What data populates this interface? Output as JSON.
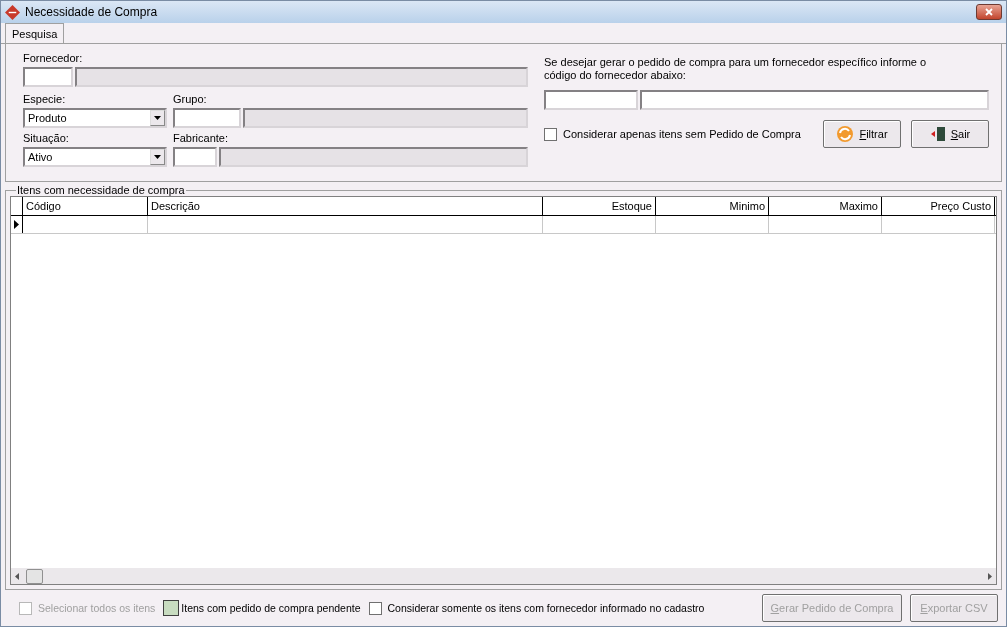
{
  "window": {
    "title": "Necessidade de Compra"
  },
  "tabs": [
    {
      "label": "Pesquisa",
      "selected": true
    }
  ],
  "filters": {
    "fornecedor": {
      "label": "Fornecedor:"
    },
    "especie": {
      "label": "Especie:",
      "value": "Produto"
    },
    "grupo": {
      "label": "Grupo:"
    },
    "situacao": {
      "label": "Situação:",
      "value": "Ativo"
    },
    "fabricante": {
      "label": "Fabricante:"
    }
  },
  "supplier_hint": "Se desejar gerar o pedido de compra para um fornecedor específico informe o código do fornecedor abaixo:",
  "only_without_order": {
    "label": "Considerar apenas itens sem Pedido de Compra",
    "checked": false
  },
  "actions": [
    {
      "label": "Filtrar",
      "kind": "refresh"
    },
    {
      "label": "Sair",
      "kind": "exit"
    }
  ],
  "grid": {
    "title": "Itens com necessidade de compra",
    "columns": [
      {
        "label": "Código"
      },
      {
        "label": "Descrição"
      },
      {
        "label": "Estoque"
      },
      {
        "label": "Minimo"
      },
      {
        "label": "Maximo"
      },
      {
        "label": "Preço Custo"
      }
    ],
    "rows": [
      {
        "current": true
      }
    ]
  },
  "footer": {
    "select_all": {
      "label": "Selecionar todos os itens",
      "checked": false,
      "disabled": true
    },
    "legend": {
      "label": "Itens com pedido de compra pendente",
      "color": "#c8dcc0"
    },
    "only_with_supplier": {
      "label": "Considerar somente os itens com fornecedor informado no cadastro",
      "checked": false
    },
    "buttons": [
      {
        "label": "Gerar Pedido de Compra",
        "disabled": true
      },
      {
        "label": "Exportar CSV",
        "disabled": true
      }
    ]
  }
}
